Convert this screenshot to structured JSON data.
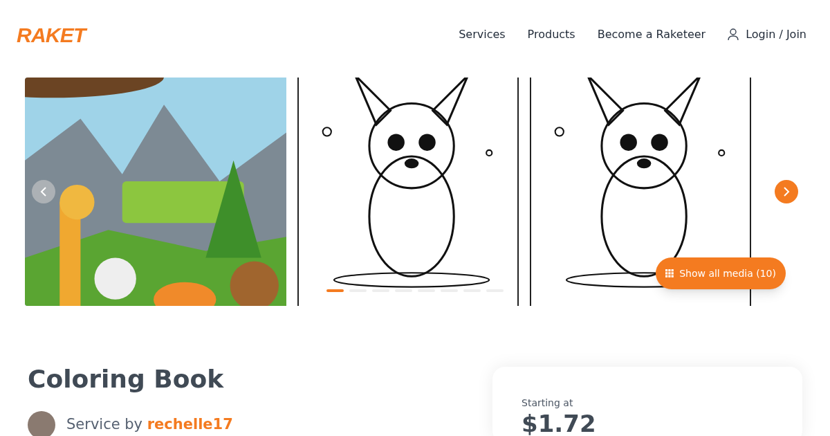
{
  "header": {
    "logo": "RAKET",
    "nav": [
      {
        "label": "Services",
        "kind": "link"
      },
      {
        "label": "Products",
        "kind": "link"
      },
      {
        "label": "Become a Raketeer",
        "kind": "link"
      },
      {
        "label": "Login / Join",
        "kind": "login"
      }
    ]
  },
  "carousel": {
    "prev": {
      "disabled": true
    },
    "next": {
      "disabled": false
    },
    "dots": [
      {
        "selected": true
      },
      {
        "selected": false
      },
      {
        "selected": false
      },
      {
        "selected": false
      },
      {
        "selected": false
      },
      {
        "selected": false
      },
      {
        "selected": false
      },
      {
        "selected": false
      }
    ],
    "show_all": "Show all media (10)"
  },
  "listing": {
    "title": "Coloring Book",
    "service_by": "Service by",
    "seller": "rechelle17"
  },
  "price": {
    "label": "Starting at",
    "value": "$1.72"
  }
}
